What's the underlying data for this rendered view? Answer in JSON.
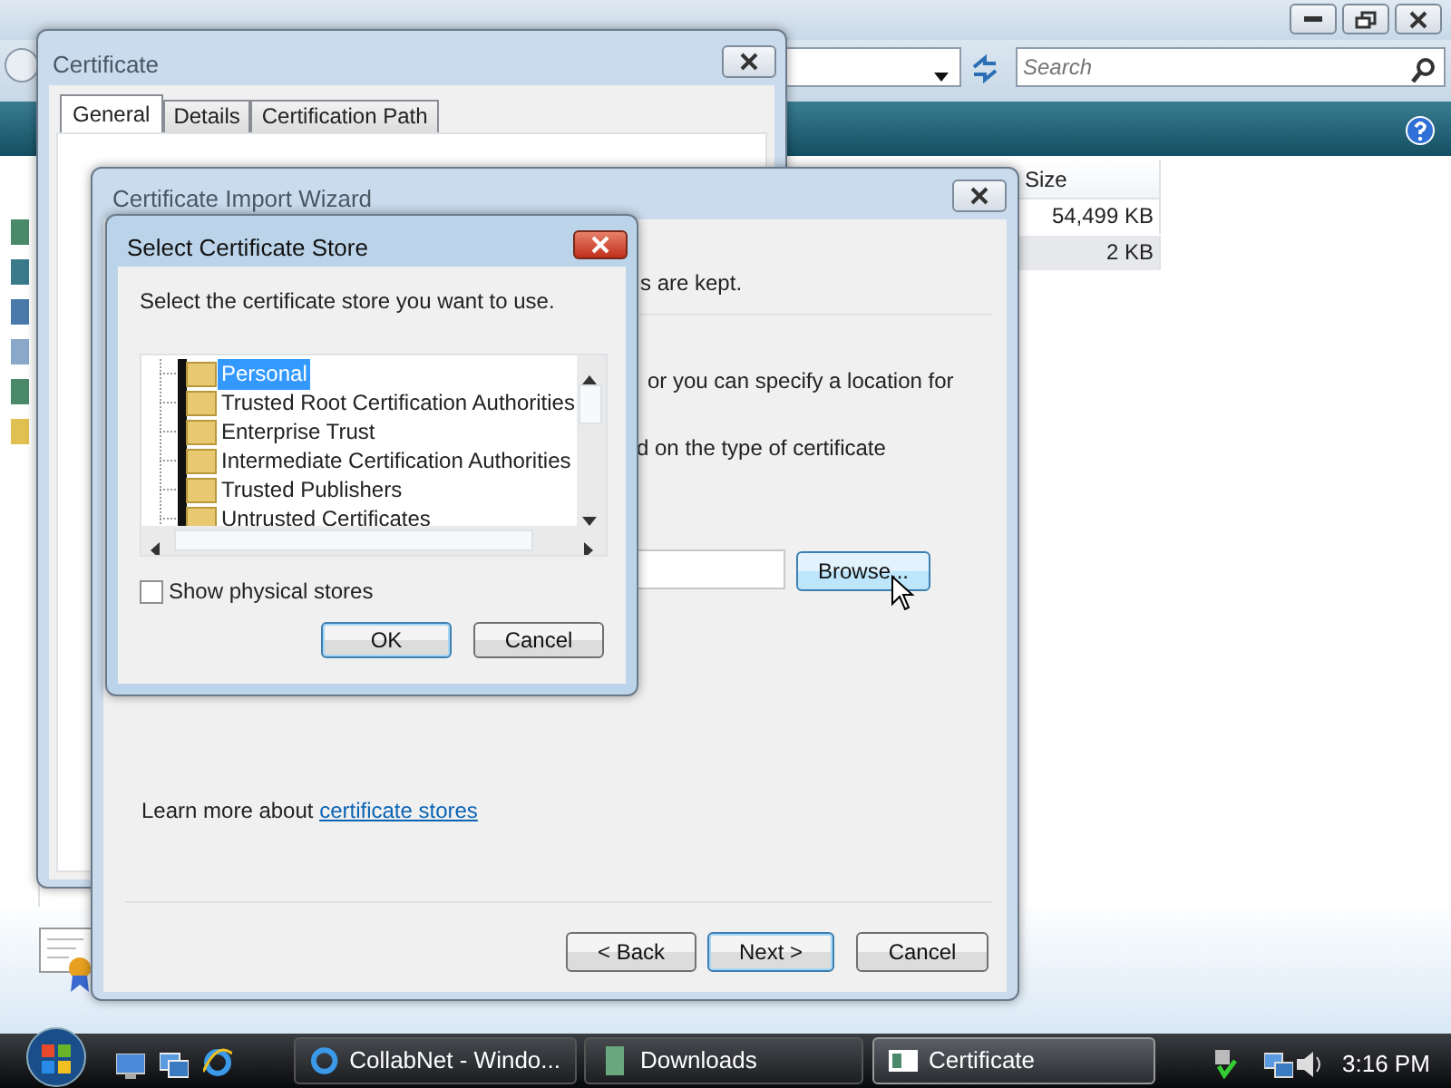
{
  "explorer": {
    "search_placeholder": "Search",
    "size_column": "Size",
    "rows": [
      {
        "size": "54,499 KB",
        "selected": false
      },
      {
        "size": "2 KB",
        "selected": true
      }
    ]
  },
  "certificate_dialog": {
    "title": "Certificate",
    "tabs": [
      {
        "label": "General",
        "selected": true
      },
      {
        "label": "Details",
        "selected": false
      },
      {
        "label": "Certification Path",
        "selected": false
      }
    ]
  },
  "import_wizard": {
    "title": "Certificate Import Wizard",
    "partial_lines": [
      "s are kept.",
      "or you can specify a location for",
      "d on the type of certificate"
    ],
    "browse_button": "Browse...",
    "learn_more": "Learn more about",
    "learn_more_link": "certificate stores",
    "buttons": [
      "< Back",
      "Next >",
      "Cancel"
    ]
  },
  "store_dialog": {
    "title": "Select Certificate Store",
    "prompt": "Select the certificate store you want to use.",
    "stores": [
      {
        "label": "Personal",
        "selected": true
      },
      {
        "label": "Trusted Root Certification Authorities",
        "selected": false
      },
      {
        "label": "Enterprise Trust",
        "selected": false
      },
      {
        "label": "Intermediate Certification Authorities",
        "selected": false
      },
      {
        "label": "Trusted Publishers",
        "selected": false
      },
      {
        "label": "Untrusted Certificates",
        "selected": false
      }
    ],
    "show_physical_stores": {
      "label": "Show physical stores",
      "checked": false
    },
    "buttons": [
      "OK",
      "Cancel"
    ]
  },
  "taskbar": {
    "tasks": [
      {
        "label": "CollabNet - Windo...",
        "selected": false
      },
      {
        "label": "Downloads",
        "selected": false
      },
      {
        "label": "Certificate",
        "selected": true
      }
    ],
    "clock": "3:16 PM"
  }
}
